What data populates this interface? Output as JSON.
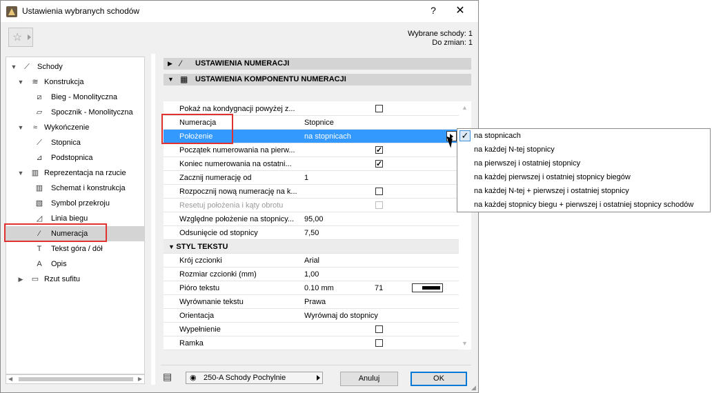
{
  "window": {
    "title": "Ustawienia wybranych schodów",
    "help": "?",
    "close": "✕"
  },
  "selection_info": {
    "selected": "Wybrane schody: 1",
    "to_change": "Do zmian: 1"
  },
  "tree": [
    {
      "label": "Schody",
      "icon": "stairs-icon",
      "level": 0,
      "expanded": true
    },
    {
      "label": "Konstrukcja",
      "icon": "structure-icon",
      "level": 1,
      "expanded": true
    },
    {
      "label": "Bieg - Monolityczna",
      "icon": "flight-icon",
      "level": 2
    },
    {
      "label": "Spocznik - Monolityczna",
      "icon": "landing-icon",
      "level": 2
    },
    {
      "label": "Wykończenie",
      "icon": "finish-icon",
      "level": 1,
      "expanded": true
    },
    {
      "label": "Stopnica",
      "icon": "tread-icon",
      "level": 2
    },
    {
      "label": "Podstopnica",
      "icon": "riser-icon",
      "level": 2
    },
    {
      "label": "Reprezentacja na rzucie",
      "icon": "floorplan-icon",
      "level": 1,
      "expanded": true
    },
    {
      "label": "Schemat i konstrukcja",
      "icon": "scheme-icon",
      "level": 2
    },
    {
      "label": "Symbol przekroju",
      "icon": "section-symbol-icon",
      "level": 2
    },
    {
      "label": "Linia biegu",
      "icon": "walkline-icon",
      "level": 2
    },
    {
      "label": "Numeracja",
      "icon": "numbering-icon",
      "level": 2,
      "selected": true
    },
    {
      "label": "Tekst góra / dół",
      "icon": "text-updown-icon",
      "level": 2
    },
    {
      "label": "Opis",
      "icon": "label-icon",
      "level": 2
    },
    {
      "label": "Rzut sufitu",
      "icon": "ceiling-plan-icon",
      "level": 1,
      "expanded": false
    }
  ],
  "sections": {
    "numbering_settings": "USTAWIENIA NUMERACJI",
    "numbering_component": "USTAWIENIA KOMPONENTU NUMERACJI"
  },
  "props": [
    {
      "label": "Pokaż na kondygnacji powyżej z...",
      "check": false
    },
    {
      "label": "Numeracja",
      "value": "Stopnice"
    },
    {
      "label": "Położenie",
      "value": "na stopnicach",
      "highlight": true,
      "dropdown": true
    },
    {
      "label": "Początek numerowania na pierw...",
      "check": true
    },
    {
      "label": "Koniec numerowania na ostatni...",
      "check": true
    },
    {
      "label": "Zacznij numerację od",
      "value": "1"
    },
    {
      "label": "Rozpocznij nową numerację na k...",
      "check": false
    },
    {
      "label": "Resetuj położenia i kąty obrotu",
      "check": false,
      "disabled": true
    },
    {
      "label": "Względne położenie na stopnicy...",
      "value": "95,00"
    },
    {
      "label": "Odsunięcie od stopnicy",
      "value": "7,50"
    },
    {
      "label": "STYL TEKSTU",
      "subheader": true
    },
    {
      "label": "Krój czcionki",
      "value": "Arial"
    },
    {
      "label": "Rozmiar czcionki (mm)",
      "value": "1,00"
    },
    {
      "label": "Pióro tekstu",
      "value": "0.10 mm",
      "value2": "71",
      "pen": true
    },
    {
      "label": "Wyrównanie tekstu",
      "value": "Prawa"
    },
    {
      "label": "Orientacja",
      "value": "Wyrównaj do stopnicy"
    },
    {
      "label": "Wypełnienie",
      "check": false
    },
    {
      "label": "Ramka",
      "check": false
    }
  ],
  "popup_options": [
    "na stopnicach",
    "na każdej N-tej stopnicy",
    "na pierwszej i ostatniej stopnicy",
    "na każdej pierwszej i ostatniej stopnicy biegów",
    "na każdej N-tej + pierwszej i ostatniej stopnicy",
    "na każdej stopnicy biegu + pierwszej i ostatniej stopnicy schodów"
  ],
  "popup_selected": 0,
  "footer": {
    "layer_combo": "250-A Schody Pochylnie",
    "cancel": "Anuluj",
    "ok": "OK"
  }
}
